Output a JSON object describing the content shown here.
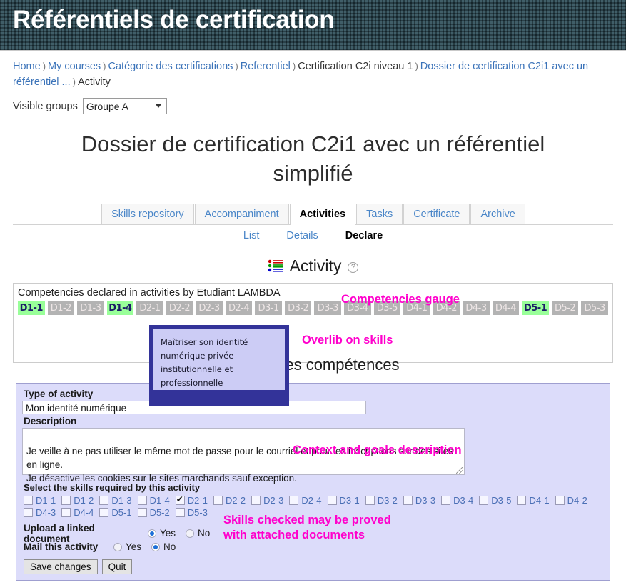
{
  "banner": {
    "title": "Référentiels de certification"
  },
  "breadcrumb": {
    "items": [
      {
        "label": "Home",
        "link": true
      },
      {
        "label": "My courses",
        "link": true
      },
      {
        "label": "Catégorie des certifications",
        "link": true
      },
      {
        "label": "Referentiel",
        "link": true
      },
      {
        "label": "Certification C2i niveau 1",
        "link": false
      },
      {
        "label": "Dossier de certification C2i1 avec un référentiel ...",
        "link": true
      },
      {
        "label": "Activity",
        "link": false
      }
    ],
    "separator": ")"
  },
  "groups": {
    "label": "Visible groups",
    "selected": "Groupe A",
    "options": [
      "Groupe A"
    ]
  },
  "page_title": "Dossier de certification C2i1 avec un référentiel simplifié",
  "tabs": [
    {
      "label": "Skills repository",
      "active": false
    },
    {
      "label": "Accompaniment",
      "active": false
    },
    {
      "label": "Activities",
      "active": true
    },
    {
      "label": "Tasks",
      "active": false
    },
    {
      "label": "Certificate",
      "active": false
    },
    {
      "label": "Archive",
      "active": false
    }
  ],
  "subtabs": [
    {
      "label": "List",
      "active": false
    },
    {
      "label": "Details",
      "active": false
    },
    {
      "label": "Declare",
      "active": true
    }
  ],
  "activity_heading": {
    "label": "Activity",
    "help": "?",
    "icon": "list-icon"
  },
  "gauge": {
    "caption": "Competencies declared in activities by Etudiant LAMBDA",
    "badges": [
      {
        "label": "D1-1",
        "on": true
      },
      {
        "label": "D1-2",
        "on": false
      },
      {
        "label": "D1-3",
        "on": false
      },
      {
        "label": "D1-4",
        "on": true
      },
      {
        "label": "D2-1",
        "on": false
      },
      {
        "label": "D2-2",
        "on": false
      },
      {
        "label": "D2-3",
        "on": false
      },
      {
        "label": "D2-4",
        "on": false
      },
      {
        "label": "D3-1",
        "on": false
      },
      {
        "label": "D3-2",
        "on": false
      },
      {
        "label": "D3-3",
        "on": false
      },
      {
        "label": "D3-4",
        "on": false
      },
      {
        "label": "D3-5",
        "on": false
      },
      {
        "label": "D4-1",
        "on": false
      },
      {
        "label": "D4-2",
        "on": false
      },
      {
        "label": "D4-3",
        "on": false
      },
      {
        "label": "D4-4",
        "on": false
      },
      {
        "label": "D5-1",
        "on": true
      },
      {
        "label": "D5-2",
        "on": false
      },
      {
        "label": "D5-3",
        "on": false
      }
    ]
  },
  "annotations": {
    "gauge": "Competencies gauge",
    "overlib": "Overlib on skills",
    "description": "Context and goals description",
    "skills": "Skills checked may be proved\nwith attached documents"
  },
  "tooltip": {
    "text": "Maîtriser son identité numérique privée institutionnelle et professionnelle"
  },
  "declare_heading": "ivité et des compétences",
  "form": {
    "type_label": "Type of activity",
    "type_value": "Mon identité numérique",
    "description_label": "Description",
    "description_value": "Je veille à ne pas utiliser le même mot de passe pour le courriel et pour les inscriptions sur des sites en ligne.\nJe désactive les cookies sur le sites marchands sauf exception.",
    "skills_label": "Select the skills required by this activity",
    "skills": [
      {
        "label": "D1-1",
        "checked": false
      },
      {
        "label": "D1-2",
        "checked": false
      },
      {
        "label": "D1-3",
        "checked": false
      },
      {
        "label": "D1-4",
        "checked": false
      },
      {
        "label": "D2-1",
        "checked": true
      },
      {
        "label": "D2-2",
        "checked": false
      },
      {
        "label": "D2-3",
        "checked": false
      },
      {
        "label": "D2-4",
        "checked": false
      },
      {
        "label": "D3-1",
        "checked": false
      },
      {
        "label": "D3-2",
        "checked": false
      },
      {
        "label": "D3-3",
        "checked": false
      },
      {
        "label": "D3-4",
        "checked": false
      },
      {
        "label": "D3-5",
        "checked": false
      },
      {
        "label": "D4-1",
        "checked": false
      },
      {
        "label": "D4-2",
        "checked": false
      },
      {
        "label": "D4-3",
        "checked": false
      },
      {
        "label": "D4-4",
        "checked": false
      },
      {
        "label": "D5-1",
        "checked": false
      },
      {
        "label": "D5-2",
        "checked": false
      },
      {
        "label": "D5-3",
        "checked": false
      }
    ],
    "upload_label": "Upload a linked document",
    "upload_value": "Yes",
    "mail_label": "Mail this activity",
    "mail_value": "No",
    "yes_label": "Yes",
    "no_label": "No",
    "save_label": "Save changes",
    "quit_label": "Quit"
  },
  "colors": {
    "banner_bg": "#2b4c57",
    "link": "#3b73b9",
    "annotation": "#ff00cc",
    "badge_on": "#99ff99",
    "badge_off": "#b3b3b3",
    "panel_bg": "#dcdcfa",
    "tooltip_border": "#333399",
    "tooltip_bg": "#ccccf5"
  }
}
